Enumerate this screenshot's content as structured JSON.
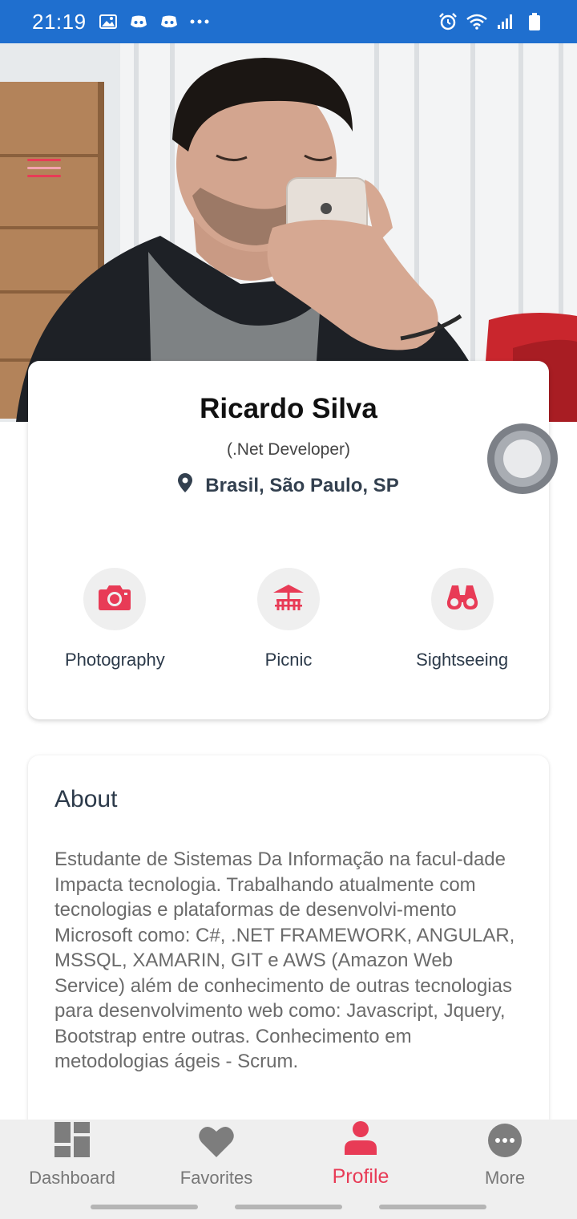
{
  "status_bar": {
    "time": "21:19",
    "background": "#1f6fcf",
    "left_icons": [
      "image-icon",
      "discord-icon",
      "discord-icon",
      "more-dots-icon"
    ],
    "right_icons": [
      "alarm-icon",
      "wifi-icon",
      "signal-icon",
      "battery-icon"
    ]
  },
  "hero": {
    "menu_icon": "hamburger-menu-icon"
  },
  "profile": {
    "name": "Ricardo Silva",
    "role": "(.Net Developer)",
    "location": "Brasil, São Paulo, SP",
    "location_icon": "map-pin-icon",
    "interests": [
      {
        "label": "Photography",
        "icon": "camera-icon"
      },
      {
        "label": "Picnic",
        "icon": "picnic-icon"
      },
      {
        "label": "Sightseeing",
        "icon": "binoculars-icon"
      }
    ]
  },
  "about": {
    "title": "About",
    "text": "Estudante de Sistemas Da Informação na facul-dade Impacta tecnologia. Trabalhando atualmente com tecnologias e plataformas de desenvolvi-mento Microsoft como: C#, .NET FRAMEWORK, ANGULAR, MSSQL, XAMARIN, GIT e AWS (Amazon Web Service) além de conhecimento de outras tecnologias para desenvolvimento web como: Javascript, Jquery, Bootstrap entre outras. Conhecimento em metodologias ágeis - Scrum."
  },
  "bottom_nav": {
    "items": [
      {
        "label": "Dashboard",
        "icon": "dashboard-icon",
        "active": false
      },
      {
        "label": "Favorites",
        "icon": "heart-icon",
        "active": false
      },
      {
        "label": "Profile",
        "icon": "person-icon",
        "active": true
      },
      {
        "label": "More",
        "icon": "more-icon",
        "active": false
      }
    ]
  },
  "colors": {
    "accent": "#e83b56",
    "text_dark": "#2c3a4a",
    "muted": "#777777",
    "status_bar": "#1f6fcf"
  }
}
